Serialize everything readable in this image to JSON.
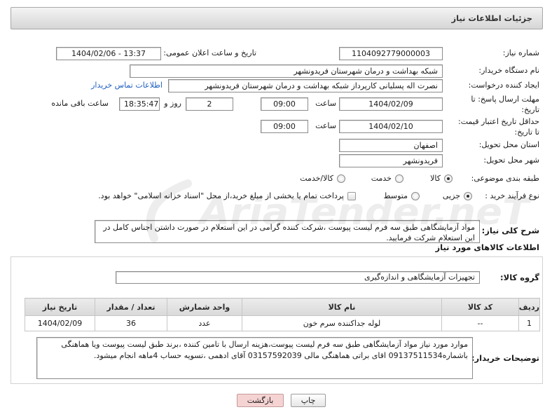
{
  "page": {
    "title": "جزئیات اطلاعات نیاز"
  },
  "watermark": "AriaTender.neT",
  "fields": {
    "need_number": {
      "label": "شماره نیاز:",
      "value": "1104092779000003"
    },
    "announce_datetime": {
      "label": "تاریخ و ساعت اعلان عمومی:",
      "value": "1404/02/06 - 13:37"
    },
    "buyer_org": {
      "label": "نام دستگاه خریدار:",
      "value": "شبکه بهداشت و درمان شهرستان فریدونشهر"
    },
    "requester": {
      "label": "ایجاد کننده درخواست:",
      "value": "نصرت اله پسلیانی کارپرداز شبکه بهداشت و درمان شهرستان فریدونشهر",
      "contact_link": "اطلاعات تماس خریدار"
    },
    "reply_deadline": {
      "label_line1": "مهلت ارسال پاسخ: تا",
      "label_line2": "تاریخ:",
      "date": "1404/02/09",
      "time_label": "ساعت",
      "time": "09:00",
      "days": "2",
      "days_label": "روز و",
      "remaining": "18:35:47",
      "remaining_label": "ساعت باقی مانده"
    },
    "price_validity": {
      "label_line1": "حداقل تاریخ اعتبار قیمت:",
      "label_line2": "تا تاریخ:",
      "date": "1404/02/10",
      "time_label": "ساعت",
      "time": "09:00"
    },
    "province": {
      "label": "استان محل تحویل:",
      "value": "اصفهان"
    },
    "city": {
      "label": "شهر محل تحویل:",
      "value": "فریدونشهر"
    },
    "category": {
      "label": "طبقه بندی موضوعی:",
      "options": [
        {
          "label": "کالا",
          "checked": true
        },
        {
          "label": "خدمت",
          "checked": false
        },
        {
          "label": "کالا/خدمت",
          "checked": false
        }
      ]
    },
    "process": {
      "label": "نوع فرآیند خرید :",
      "options": [
        {
          "label": "جزیی",
          "checked": true
        },
        {
          "label": "متوسط",
          "checked": false
        }
      ],
      "treasury": {
        "label": "پرداخت تمام یا بخشی از مبلغ خرید،از محل \"اسناد خزانه اسلامی\" خواهد بود.",
        "checked": false
      }
    },
    "description": {
      "label": "شرح کلی نیاز:",
      "value": "مواد آزمایشگاهی طبق سه فرم لیست پیوست ،شرکت کننده گرامی در این استعلام در صورت داشتن اجناس کامل در این استعلام شرکت فرمایید."
    }
  },
  "items": {
    "heading": "اطلاعات کالاهای مورد نیاز",
    "group_label": "گروه کالا:",
    "group_value": "تجهیزات آزمایشگاهی و اندازه‌گیری",
    "columns": {
      "row": "ردیف",
      "code": "کد کالا",
      "name": "نام کالا",
      "unit": "واحد شمارش",
      "qty": "تعداد / مقدار",
      "date": "تاریخ نیاز"
    },
    "rows": [
      {
        "row": "1",
        "code": "--",
        "name": "لوله جداکننده سرم خون",
        "unit": "عدد",
        "qty": "36",
        "date": "1404/02/09"
      }
    ]
  },
  "buyer_notes": {
    "label": "توضیحات خریدار:",
    "value": "موارد مورد نیاز مواد آزمایشگاهی طبق سه فرم لیست پیوست،هزینه ارسال با تامین کننده ،برند طبق لیست پیوست ویا هماهنگی باشماره09137511534 اقای براتی هماهنگی مالی 03157592039 آقای ادهمی ،تسویه حساب 4ماهه انجام میشود."
  },
  "buttons": {
    "print": "چاپ",
    "back": "بازگشت"
  },
  "colors": {
    "link": "#1f5fbf",
    "header_bar": "#d6d6d6",
    "table_header": "#d9d9d9",
    "back_button": "#f6d3d3",
    "field_border": "#8c8c8c"
  }
}
